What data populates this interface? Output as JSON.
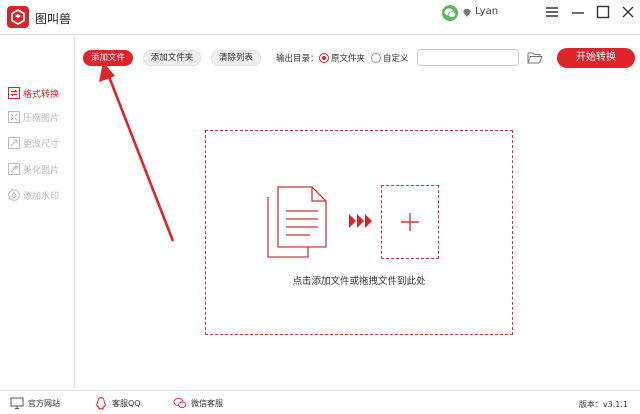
{
  "app": {
    "title": "图叫兽"
  },
  "user": {
    "name": "Lyan"
  },
  "sidebar": {
    "items": [
      {
        "label": "格式转换",
        "active": true
      },
      {
        "label": "压缩图片"
      },
      {
        "label": "更改尺寸"
      },
      {
        "label": "美化图片"
      },
      {
        "label": "添加水印"
      }
    ]
  },
  "toolbar": {
    "add_file": "添加文件",
    "add_folder": "添加文件夹",
    "clear_list": "清除列表",
    "output_label": "输出目录：",
    "radio_source": "原文件夹",
    "radio_custom": "自定义",
    "start": "开始转换"
  },
  "dropzone": {
    "hint": "点击添加文件或拖拽文件到此处"
  },
  "status": {
    "website": "官方网站",
    "qq": "客服QQ",
    "wechat": "微信客服",
    "version": "版本：v3.1.1"
  },
  "colors": {
    "accent": "#e0242a"
  }
}
